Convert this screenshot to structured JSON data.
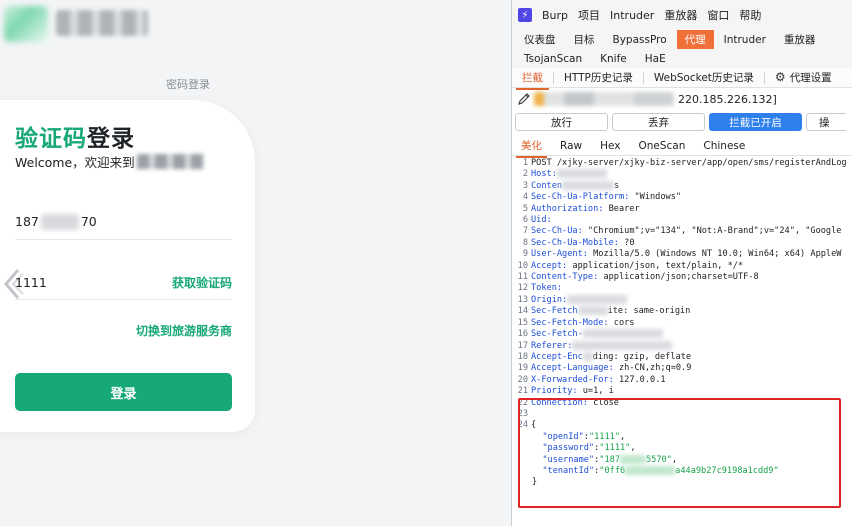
{
  "login": {
    "pwd_login": "密码登录",
    "title_green": "验证码",
    "title_black": "登录",
    "welcome": "Welcome，欢迎来到",
    "phone_prefix": "187",
    "phone_suffix": "70",
    "code_value": "1111",
    "get_code": "获取验证码",
    "switch_link": "切换到旅游服务商",
    "login_button": "登录",
    "accent": "#16a876"
  },
  "burp": {
    "menu": [
      "Burp",
      "项目",
      "Intruder",
      "重放器",
      "窗口",
      "帮助"
    ],
    "tabs_row1": [
      "仪表盘",
      "目标",
      "BypassPro",
      "代理",
      "Intruder",
      "重放器"
    ],
    "tabs_row2": [
      "TsojanScan",
      "Knife",
      "HaE"
    ],
    "proxy_tabs": [
      "拦截",
      "HTTP历史记录",
      "WebSocket历史记录"
    ],
    "proxy_settings": "代理设置",
    "host_suffix": "220.185.226.132]",
    "buttons": [
      "放行",
      "丢弃",
      "拦截已开启",
      "操"
    ],
    "view_tabs": [
      "美化",
      "Raw",
      "Hex",
      "OneScan",
      "Chinese"
    ],
    "headers": [
      {
        "no": "1",
        "key": "",
        "val": "POST /xjky-server/xjky-biz-server/app/open/sms/registerAndLog"
      },
      {
        "no": "2",
        "key": "Host:",
        "val": ""
      },
      {
        "no": "3",
        "key": "Conten",
        "val": "s"
      },
      {
        "no": "4",
        "key": "Sec-Ch-Ua-Platform:",
        "val": " \"Windows\""
      },
      {
        "no": "5",
        "key": "Authorization:",
        "val": " Bearer"
      },
      {
        "no": "6",
        "key": "Uid:",
        "val": ""
      },
      {
        "no": "7",
        "key": "Sec-Ch-Ua:",
        "val": " \"Chromium\";v=\"134\", \"Not:A-Brand\";v=\"24\", \"Google"
      },
      {
        "no": "8",
        "key": "Sec-Ch-Ua-Mobile:",
        "val": " ?0"
      },
      {
        "no": "9",
        "key": "User-Agent:",
        "val": " Mozilla/5.0 (Windows NT 10.0; Win64; x64) AppleW"
      },
      {
        "no": "10",
        "key": "Accept:",
        "val": " application/json, text/plain, */*"
      },
      {
        "no": "11",
        "key": "Content-Type:",
        "val": " application/json;charset=UTF-8"
      },
      {
        "no": "12",
        "key": "Token:",
        "val": ""
      },
      {
        "no": "13",
        "key": "Origin:",
        "val": ""
      },
      {
        "no": "14",
        "key": "Sec-Fetch",
        "val": "ite: same-origin"
      },
      {
        "no": "15",
        "key": "Sec-Fetch-Mode:",
        "val": " cors"
      },
      {
        "no": "16",
        "key": "Sec-Fetch-",
        "val": ""
      },
      {
        "no": "17",
        "key": "Referer:",
        "val": ""
      },
      {
        "no": "18",
        "key": "Accept-Enc",
        "val": "ding: gzip, deflate"
      },
      {
        "no": "19",
        "key": "Accept-Language:",
        "val": " zh-CN,zh;q=0.9"
      },
      {
        "no": "20",
        "key": "X-Forwarded-For:",
        "val": " 127.0.0.1"
      },
      {
        "no": "21",
        "key": "Priority:",
        "val": " u=1, i"
      },
      {
        "no": "22",
        "key": "Connection:",
        "val": " close"
      },
      {
        "no": "23",
        "key": "",
        "val": ""
      },
      {
        "no": "24",
        "key": "",
        "val": "{"
      }
    ],
    "json_body": {
      "openId_key": "\"openId\"",
      "openId_val": "\"1111\"",
      "password_key": "\"password\"",
      "password_val": "\"1111\"",
      "username_key": "\"username\"",
      "username_pre": "\"187",
      "username_post": "5570\"",
      "tenantId_key": "\"tenantId\"",
      "tenantId_pre": "\"0ff6",
      "tenantId_post": "a44a9b27c9198a1cdd9\"",
      "close": "}"
    },
    "accent_orange": "#f0703a",
    "accent_blue": "#2f80ed",
    "highlight_red": "#e02424"
  }
}
